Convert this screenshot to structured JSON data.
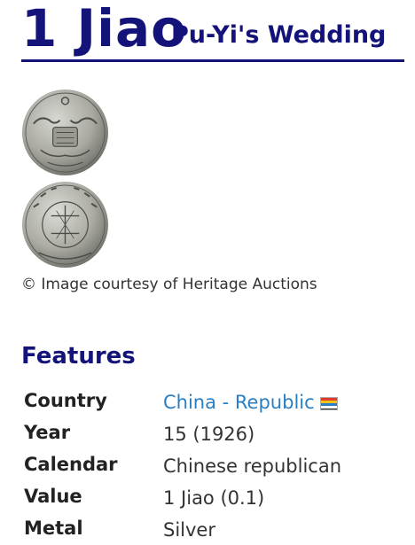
{
  "header": {
    "denomination": "1 Jiao",
    "subtitle": "Pu-Yi's Wedding"
  },
  "images": {
    "obverse_icon": "coin-obverse-dragon-phoenix",
    "reverse_icon": "coin-reverse-text",
    "credit": "© Image courtesy of Heritage Auctions"
  },
  "features": {
    "heading": "Features",
    "rows": [
      {
        "key": "Country",
        "value": "China - Republic",
        "link": true,
        "flag": "five-races-flag"
      },
      {
        "key": "Year",
        "value": "15 (1926)"
      },
      {
        "key": "Calendar",
        "value": "Chinese republican"
      },
      {
        "key": "Value",
        "value": "1 Jiao (0.1)"
      },
      {
        "key": "Metal",
        "value": "Silver"
      }
    ]
  },
  "colors": {
    "heading": "#13137a",
    "link": "#2a7fc4",
    "flag_stripes": [
      "#e23b2a",
      "#f2c21b",
      "#2a7fc4",
      "#ffffff",
      "#222222"
    ]
  }
}
